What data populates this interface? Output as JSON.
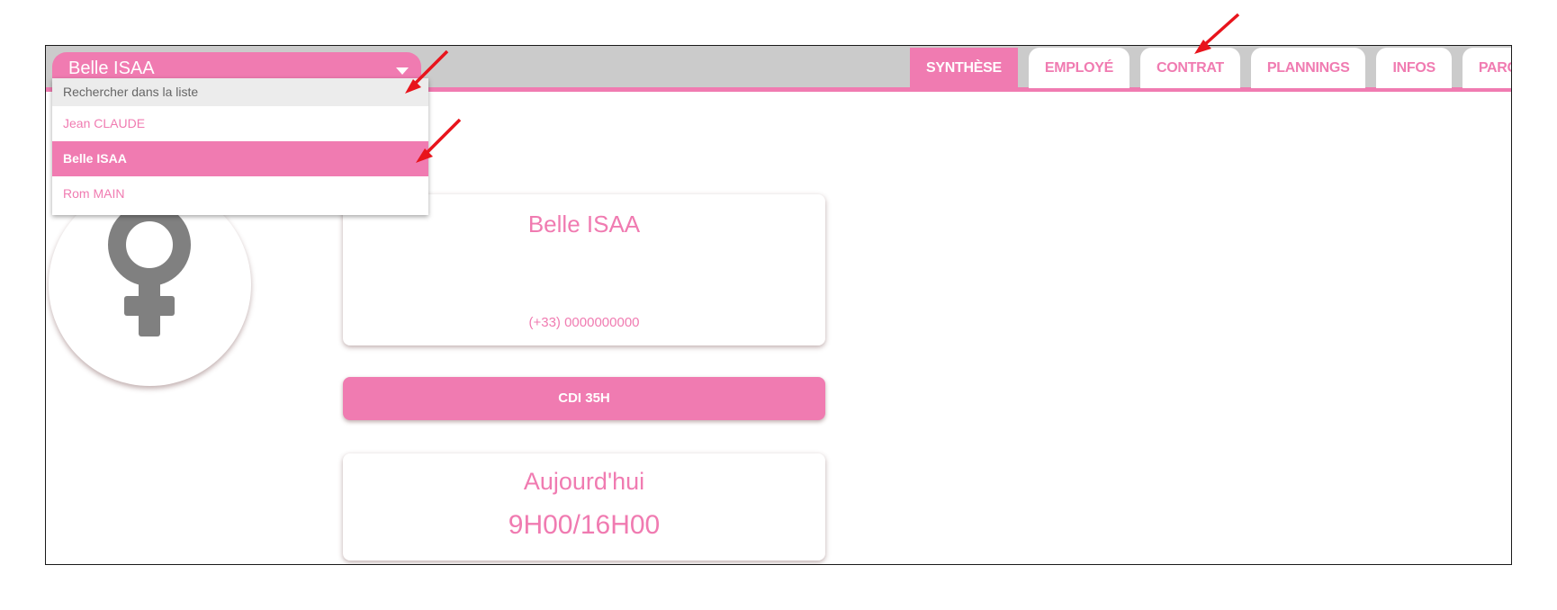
{
  "employee_selector": {
    "selected": "Belle ISAA"
  },
  "tabs": [
    {
      "label": "SYNTHÈSE",
      "active": true
    },
    {
      "label": "EMPLOYÉ",
      "active": false
    },
    {
      "label": "CONTRAT",
      "active": false
    },
    {
      "label": "PLANNINGS",
      "active": false
    },
    {
      "label": "INFOS",
      "active": false
    },
    {
      "label": "PARCOURS",
      "active": false
    }
  ],
  "dropdown": {
    "search_placeholder": "Rechercher dans la liste",
    "options": [
      {
        "label": "Jean CLAUDE",
        "selected": false
      },
      {
        "label": "Belle ISAA",
        "selected": true
      },
      {
        "label": "Rom MAIN",
        "selected": false
      }
    ]
  },
  "avatar": {
    "icon": "female-symbol-icon"
  },
  "profile_card": {
    "name": "Belle ISAA",
    "phone": "(+33) 0000000000"
  },
  "contract": {
    "label": "CDI 35H"
  },
  "today_card": {
    "label": "Aujourd'hui",
    "hours": "9H00/16H00"
  },
  "colors": {
    "accent": "#f07bb1",
    "topbar": "#cbcbcb",
    "icon_gray": "#808080",
    "annotation": "#e8141c"
  }
}
